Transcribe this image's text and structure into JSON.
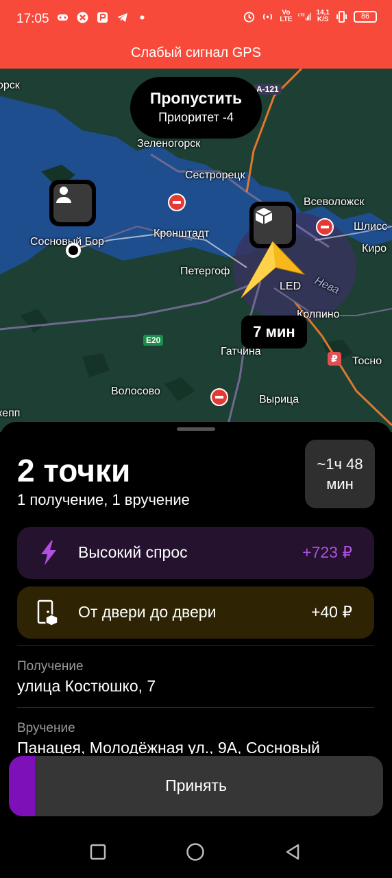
{
  "status_bar": {
    "time": "17:05",
    "net_vo": "Vo",
    "net_lte": "LTE",
    "net_lte2": "LTE",
    "speed": "14,1",
    "speed_unit": "K/S",
    "battery": "86",
    "color": "#f74a3b"
  },
  "gps_banner": "Слабый сигнал GPS",
  "map": {
    "skip_title": "Пропустить",
    "skip_priority": "Приоритет -4",
    "eta": "7 мин",
    "labels": {
      "orsk": "орск",
      "a121": "А-121",
      "zelenogorsk": "Зеленогорск",
      "sestroretsk": "Сестрорецк",
      "vsevolozhsk": "Всеволожск",
      "shlis": "Шлисс",
      "sosnovy_bor": "Сосновый Бор",
      "kronshtadt": "Кронштадт",
      "kiro": "Киро",
      "petergof": "Петергоф",
      "led": "LED",
      "neva": "Нева",
      "kolpino": "Колпино",
      "e20": "E20",
      "gatchina": "Гатчина",
      "tosno": "Тосно",
      "volosovo": "Волосово",
      "vyritsa": "Вырица",
      "kepp": "кепп"
    }
  },
  "order": {
    "title": "2 точки",
    "subtitle": "1 получение, 1 вручение",
    "eta_line1": "~1ч 48",
    "eta_line2": "мин",
    "demand_label": "Высокий спрос",
    "demand_amount": "+723 ₽",
    "door_label": "От двери до двери",
    "door_amount": "+40 ₽",
    "pickup_label": "Получение",
    "pickup_address": "улица Костюшко, 7",
    "delivery_label": "Вручение",
    "delivery_address": "Панацея, Молодёжная ул., 9А, Сосновый"
  },
  "accept": {
    "label": "Принять",
    "progress": 0.07,
    "accent": "#7d10b8"
  },
  "nav_icons": [
    "recents-icon",
    "home-icon",
    "back-icon"
  ]
}
